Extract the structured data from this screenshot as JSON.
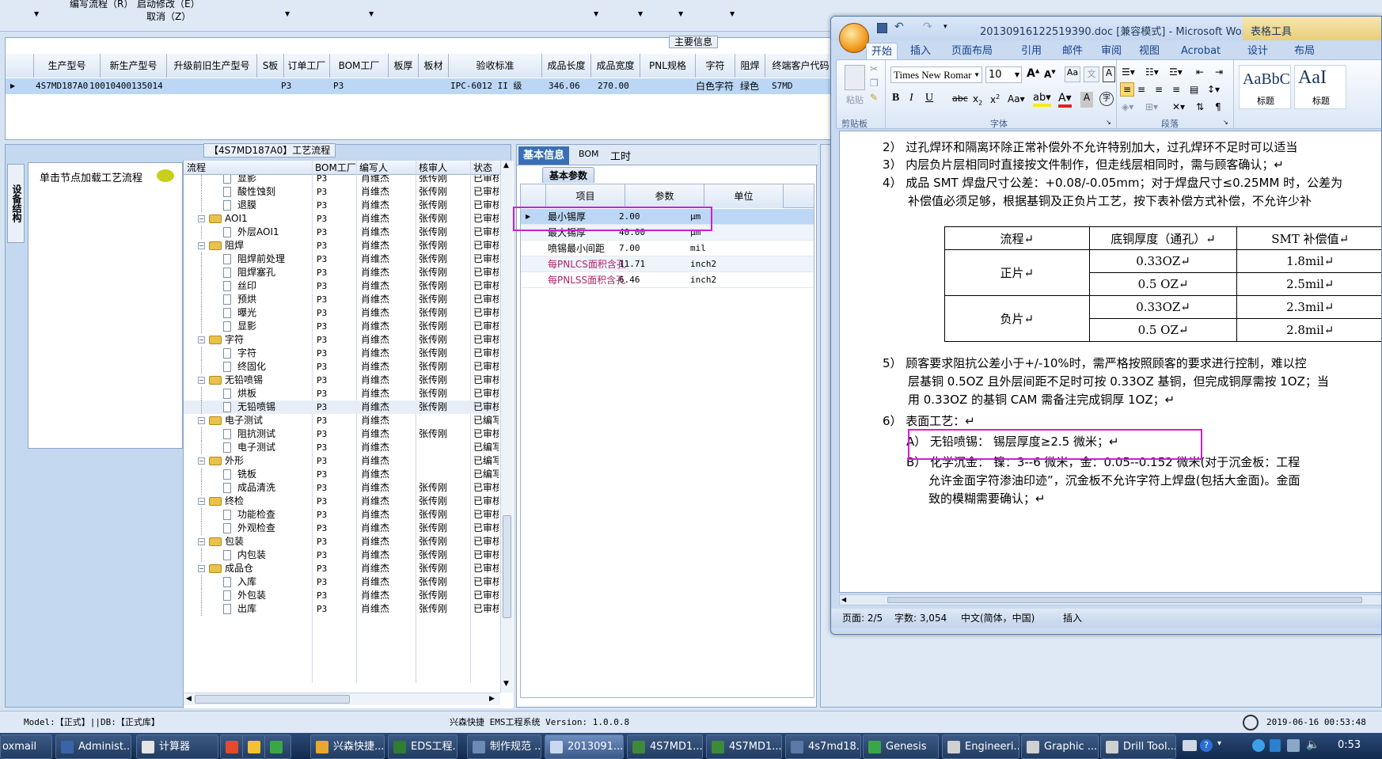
{
  "app": {
    "top_menu": [
      "编写流程（R）",
      "启动修改（E）",
      "取消（Z）"
    ],
    "main_info_label": "主要信息",
    "status_bar": "Model:【正式】||DB:【正式库】",
    "system_name": "兴森快捷 EMS工程系统 Version: 1.0.0.8",
    "datetime": "2019-06-16 00:53:48"
  },
  "main_grid": {
    "headers": [
      "生产型号",
      "新生产型号",
      "升级前旧生产型号",
      "S板",
      "订单工厂",
      "BOM工厂",
      "板厚",
      "板材",
      "验收标准",
      "成品长度",
      "成品宽度",
      "PNL规格",
      "字符",
      "阻焊",
      "终端客户代码"
    ],
    "row": [
      "4S7MD187A0",
      "10010400135014",
      "",
      "",
      "P3",
      "P3",
      "",
      "",
      "IPC-6012 II 级",
      "346.06",
      "270.00",
      "",
      "白色字符",
      "绿色",
      "S7MD"
    ]
  },
  "process": {
    "title": "【4S7MD187A0】工艺流程",
    "side_tab": "设备结构",
    "hint": "单击节点加载工艺流程",
    "headers": [
      "流程",
      "BOM工厂",
      "编写人",
      "核审人",
      "状态"
    ],
    "rows": [
      {
        "name": "显影",
        "level": 2,
        "bom": "P3",
        "writer": "肖维杰",
        "reviewer": "张传刚",
        "status": "已审核"
      },
      {
        "name": "酸性蚀刻",
        "level": 2,
        "bom": "P3",
        "writer": "肖维杰",
        "reviewer": "张传刚",
        "status": "已审核"
      },
      {
        "name": "退膜",
        "level": 2,
        "bom": "P3",
        "writer": "肖维杰",
        "reviewer": "张传刚",
        "status": "已审核"
      },
      {
        "name": "AOI1",
        "level": 1,
        "bom": "P3",
        "writer": "肖维杰",
        "reviewer": "张传刚",
        "status": "已审核"
      },
      {
        "name": "外层AOI1",
        "level": 2,
        "bom": "P3",
        "writer": "肖维杰",
        "reviewer": "张传刚",
        "status": "已审核"
      },
      {
        "name": "阻焊",
        "level": 1,
        "bom": "P3",
        "writer": "肖维杰",
        "reviewer": "张传刚",
        "status": "已审核"
      },
      {
        "name": "阻焊前处理",
        "level": 2,
        "bom": "P3",
        "writer": "肖维杰",
        "reviewer": "张传刚",
        "status": "已审核"
      },
      {
        "name": "阻焊塞孔",
        "level": 2,
        "bom": "P3",
        "writer": "肖维杰",
        "reviewer": "张传刚",
        "status": "已审核"
      },
      {
        "name": "丝印",
        "level": 2,
        "bom": "P3",
        "writer": "肖维杰",
        "reviewer": "张传刚",
        "status": "已审核"
      },
      {
        "name": "预烘",
        "level": 2,
        "bom": "P3",
        "writer": "肖维杰",
        "reviewer": "张传刚",
        "status": "已审核"
      },
      {
        "name": "曝光",
        "level": 2,
        "bom": "P3",
        "writer": "肖维杰",
        "reviewer": "张传刚",
        "status": "已审核"
      },
      {
        "name": "显影",
        "level": 2,
        "bom": "P3",
        "writer": "肖维杰",
        "reviewer": "张传刚",
        "status": "已审核"
      },
      {
        "name": "字符",
        "level": 1,
        "bom": "P3",
        "writer": "肖维杰",
        "reviewer": "张传刚",
        "status": "已审核"
      },
      {
        "name": "字符",
        "level": 2,
        "bom": "P3",
        "writer": "肖维杰",
        "reviewer": "张传刚",
        "status": "已审核"
      },
      {
        "name": "终固化",
        "level": 2,
        "bom": "P3",
        "writer": "肖维杰",
        "reviewer": "张传刚",
        "status": "已审核"
      },
      {
        "name": "无铅喷锡",
        "level": 1,
        "bom": "P3",
        "writer": "肖维杰",
        "reviewer": "张传刚",
        "status": "已审核"
      },
      {
        "name": "烘板",
        "level": 2,
        "bom": "P3",
        "writer": "肖维杰",
        "reviewer": "张传刚",
        "status": "已审核"
      },
      {
        "name": "无铅喷锡",
        "level": 2,
        "bom": "P3",
        "writer": "肖维杰",
        "reviewer": "张传刚",
        "status": "已审核"
      },
      {
        "name": "电子测试",
        "level": 1,
        "bom": "P3",
        "writer": "肖维杰",
        "reviewer": "",
        "status": "已编写"
      },
      {
        "name": "阻抗测试",
        "level": 2,
        "bom": "P3",
        "writer": "肖维杰",
        "reviewer": "张传刚",
        "status": "已审核"
      },
      {
        "name": "电子测试",
        "level": 2,
        "bom": "P3",
        "writer": "肖维杰",
        "reviewer": "",
        "status": "已编写"
      },
      {
        "name": "外形",
        "level": 1,
        "bom": "P3",
        "writer": "肖维杰",
        "reviewer": "",
        "status": "已编写"
      },
      {
        "name": "铣板",
        "level": 2,
        "bom": "P3",
        "writer": "肖维杰",
        "reviewer": "",
        "status": "已编写"
      },
      {
        "name": "成品清洗",
        "level": 2,
        "bom": "P3",
        "writer": "肖维杰",
        "reviewer": "张传刚",
        "status": "已审核"
      },
      {
        "name": "终检",
        "level": 1,
        "bom": "P3",
        "writer": "肖维杰",
        "reviewer": "张传刚",
        "status": "已审核"
      },
      {
        "name": "功能检查",
        "level": 2,
        "bom": "P3",
        "writer": "肖维杰",
        "reviewer": "张传刚",
        "status": "已审核"
      },
      {
        "name": "外观检查",
        "level": 2,
        "bom": "P3",
        "writer": "肖维杰",
        "reviewer": "张传刚",
        "status": "已审核"
      },
      {
        "name": "包装",
        "level": 1,
        "bom": "P3",
        "writer": "肖维杰",
        "reviewer": "张传刚",
        "status": "已审核"
      },
      {
        "name": "内包装",
        "level": 2,
        "bom": "P3",
        "writer": "肖维杰",
        "reviewer": "张传刚",
        "status": "已审核"
      },
      {
        "name": "成品仓",
        "level": 1,
        "bom": "P3",
        "writer": "肖维杰",
        "reviewer": "张传刚",
        "status": "已审核"
      },
      {
        "name": "入库",
        "level": 2,
        "bom": "P3",
        "writer": "肖维杰",
        "reviewer": "张传刚",
        "status": "已审核"
      },
      {
        "name": "外包装",
        "level": 2,
        "bom": "P3",
        "writer": "肖维杰",
        "reviewer": "张传刚",
        "status": "已审核"
      },
      {
        "name": "出库",
        "level": 2,
        "bom": "P3",
        "writer": "肖维杰",
        "reviewer": "张传刚",
        "status": "已审核"
      }
    ]
  },
  "params": {
    "tabs": [
      "基本信息",
      "BOM",
      "工时"
    ],
    "subtab": "基本参数",
    "headers": [
      "项目",
      "参数",
      "单位"
    ],
    "rows": [
      {
        "item": "最小锡厚",
        "value": "2.00",
        "unit": "μm"
      },
      {
        "item": "最大锡厚",
        "value": "40.00",
        "unit": "μm"
      },
      {
        "item": "喷锡最小间距",
        "value": "7.00",
        "unit": "mil"
      },
      {
        "item": "每PNLCS面积含孔",
        "value": "11.71",
        "unit": "inch2"
      },
      {
        "item": "每PNLSS面积含孔",
        "value": "6.46",
        "unit": "inch2"
      }
    ]
  },
  "word": {
    "title": "20130916122519390.doc [兼容模式] - Microsoft Wo...",
    "context_title": "表格工具",
    "tabs": [
      "开始",
      "插入",
      "页面布局",
      "引用",
      "邮件",
      "审阅",
      "视图",
      "Acrobat",
      "设计",
      "布局"
    ],
    "font_name": "Times New Romar",
    "font_size": "10",
    "group_labels": [
      "剪贴板",
      "字体",
      "段落"
    ],
    "paste_label": "粘贴",
    "style_sample": "AaBbC",
    "style_sample2": "AaI",
    "style_label": "标题",
    "status": {
      "page": "页面: 2/5",
      "words": "字数: 3,054",
      "lang": "中文(简体，中国)",
      "mode": "插入"
    },
    "doc_lines": [
      "2） 过孔焊环和隔离环除正常补偿外不允许特别加大，过孔焊环不足时可以适当",
      "3） 内层负片层相同时直接按文件制作，但走线层相同时，需与顾客确认；↵",
      "4） 成品 SMT 焊盘尺寸公差：+0.08/-0.05mm；对于焊盘尺寸≤0.25MM 时，公差为",
      "补偿值必须足够，根据基铜及正负片工艺，按下表补偿方式补偿，不允许少补"
    ],
    "table": {
      "headers": [
        "流程↵",
        "底铜厚度（通孔）↵",
        "SMT 补偿值↵"
      ],
      "rows": [
        [
          "正片↵",
          "0.33OZ↵",
          "1.8mil↵"
        ],
        [
          "",
          "0.5 OZ↵",
          "2.5mil↵"
        ],
        [
          "负片↵",
          "0.33OZ↵",
          "2.3mil↵"
        ],
        [
          "",
          "0.5 OZ↵",
          "2.8mil↵"
        ]
      ]
    },
    "doc_lines2": [
      "5） 顾客要求阻抗公差小于+/-10%时，需严格按照顾客的要求进行控制，难以控",
      "层基铜 0.5OZ 且外层间距不足时可按 0.33OZ 基铜，但完成铜厚需按 1OZ；当",
      "用 0.33OZ 的基铜 CAM 需备注完成铜厚 1OZ；↵",
      "6） 表面工艺：↵",
      "A） 无铅喷锡：  锡层厚度≥2.5 微米；↵",
      "B） 化学沉金：  镍：3--6 微米，金：0.05--0.152 微米(对于沉金板：工程",
      "允许金面字符渗油印迹”，沉金板不允许字符上焊盘(包括大金面)。金面",
      "致的模糊需要确认；↵"
    ]
  },
  "taskbar": {
    "items": [
      "oxmail",
      "Administ...",
      "计算器",
      "",
      "",
      "",
      "兴森快捷...",
      "EDS工程...",
      "制作规范 ...",
      "2013091...",
      "4S7MD1...",
      "4S7MD1...",
      "4s7md18...",
      "Genesis",
      "Engineeri...",
      "Graphic ...",
      "Drill Tool..."
    ],
    "clock": "0:53"
  },
  "colors": {
    "highlight_box": "#d21fd2",
    "selected_row": "#bcd7f5",
    "word_blue": "#c9daf1"
  }
}
